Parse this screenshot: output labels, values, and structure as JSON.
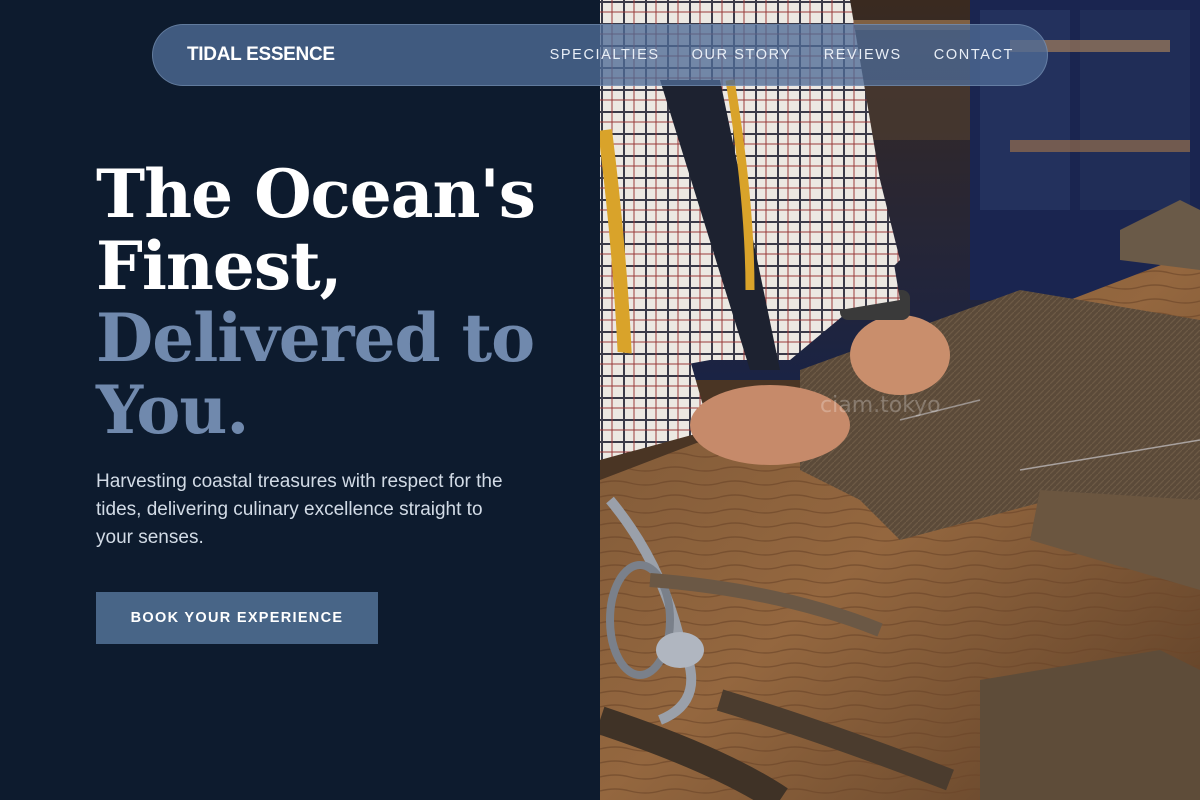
{
  "brand": {
    "name": "TIDAL ESSENCE"
  },
  "nav": {
    "links": [
      {
        "label": "SPECIALTIES"
      },
      {
        "label": "OUR STORY"
      },
      {
        "label": "REVIEWS"
      },
      {
        "label": "CONTACT"
      }
    ]
  },
  "hero": {
    "headline_line1": "The Ocean's Finest,",
    "headline_line2": "Delivered to You.",
    "subtext": "Harvesting coastal treasures with respect for the tides, delivering culinary excellence straight to your senses.",
    "cta_label": "BOOK YOUR EXPERIENCE",
    "image_watermark": "ciam.tokyo"
  },
  "colors": {
    "background": "#0d1b2e",
    "accent": "#486587",
    "headline_secondary": "#7089ad",
    "nav_bg": "#506c96"
  }
}
